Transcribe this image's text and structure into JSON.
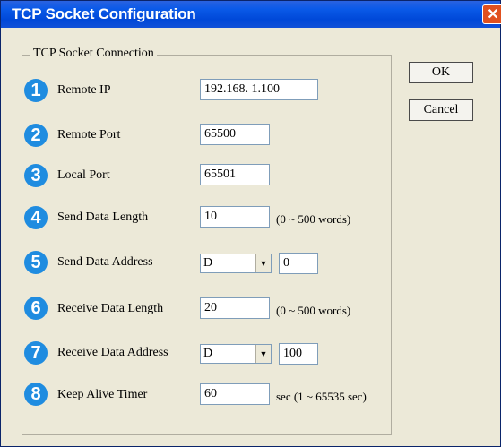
{
  "window": {
    "title": "TCP Socket Configuration",
    "close_glyph": "✕"
  },
  "group": {
    "legend": "TCP Socket Connection"
  },
  "buttons": {
    "ok": "OK",
    "cancel": "Cancel"
  },
  "rows": [
    {
      "num": "1",
      "label": "Remote IP",
      "value": "192.168.  1.100"
    },
    {
      "num": "2",
      "label": "Remote Port",
      "value": "65500"
    },
    {
      "num": "3",
      "label": "Local Port",
      "value": "65501"
    },
    {
      "num": "4",
      "label": "Send Data Length",
      "value": "10",
      "note": "(0 ~ 500 words)"
    },
    {
      "num": "5",
      "label": "Send Data Address",
      "select": "D",
      "value": "0"
    },
    {
      "num": "6",
      "label": "Receive Data Length",
      "value": "20",
      "note": "(0 ~ 500 words)"
    },
    {
      "num": "7",
      "label": "Receive Data Address",
      "select": "D",
      "value": "100"
    },
    {
      "num": "8",
      "label": "Keep Alive Timer",
      "value": "60",
      "note": "sec (1 ~ 65535 sec)"
    }
  ],
  "colors": {
    "title_bar": "#0a5ae8",
    "badge": "#1f8ce0",
    "close_button": "#e0501f"
  },
  "icons": {
    "close": "close-icon",
    "dropdown": "chevron-down-icon"
  }
}
